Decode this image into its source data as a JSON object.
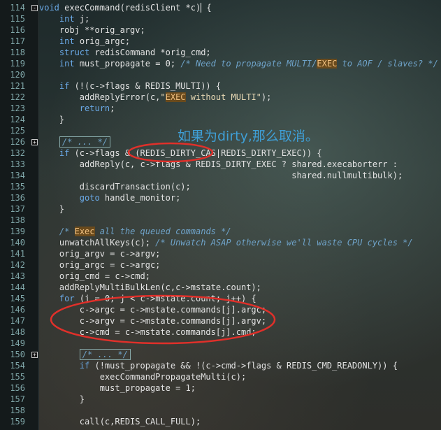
{
  "editor": {
    "lines": [
      {
        "num": "114",
        "fold": "-",
        "code": [
          [
            "void",
            "kw"
          ],
          [
            " execCommand(redisClient *c)",
            ""
          ],
          [
            "",
            "cursor"
          ],
          [
            " {",
            ""
          ]
        ]
      },
      {
        "num": "115",
        "code": [
          [
            "    ",
            ""
          ],
          [
            "int",
            "kw"
          ],
          [
            " j;",
            ""
          ]
        ]
      },
      {
        "num": "116",
        "code": [
          [
            "    robj **orig_argv;",
            ""
          ]
        ]
      },
      {
        "num": "117",
        "code": [
          [
            "    ",
            ""
          ],
          [
            "int",
            "kw"
          ],
          [
            " orig_argc;",
            ""
          ]
        ]
      },
      {
        "num": "118",
        "code": [
          [
            "    ",
            ""
          ],
          [
            "struct",
            "kw"
          ],
          [
            " redisCommand *orig_cmd;",
            ""
          ]
        ]
      },
      {
        "num": "119",
        "code": [
          [
            "    ",
            ""
          ],
          [
            "int",
            "kw"
          ],
          [
            " must_propagate = 0; ",
            ""
          ],
          [
            "/* Need to propagate MULTI/",
            "cm"
          ],
          [
            "EXEC",
            "hl"
          ],
          [
            " to AOF / slaves? */",
            "cm"
          ]
        ]
      },
      {
        "num": "120",
        "code": []
      },
      {
        "num": "121",
        "code": [
          [
            "    ",
            ""
          ],
          [
            "if",
            "kw"
          ],
          [
            " (!(c->flags & REDIS_MULTI)) {",
            ""
          ]
        ]
      },
      {
        "num": "122",
        "code": [
          [
            "        addReplyError(c,",
            ""
          ],
          [
            "\"",
            "str"
          ],
          [
            "EXEC",
            "hl"
          ],
          [
            " without MULTI\"",
            "str"
          ],
          [
            ");",
            ""
          ]
        ]
      },
      {
        "num": "123",
        "code": [
          [
            "        ",
            ""
          ],
          [
            "return",
            "kw"
          ],
          [
            ";",
            ""
          ]
        ]
      },
      {
        "num": "124",
        "code": [
          [
            "    }",
            ""
          ]
        ]
      },
      {
        "num": "125",
        "code": []
      },
      {
        "num": "126",
        "fold": "+",
        "code": [
          [
            "    ",
            ""
          ],
          [
            "/* ... */",
            "fold-box"
          ]
        ]
      },
      {
        "num": "132",
        "code": [
          [
            "    ",
            ""
          ],
          [
            "if",
            "kw"
          ],
          [
            " (c->flags & (REDIS_DIRTY_CAS|REDIS_DIRTY_EXEC)) {",
            ""
          ]
        ]
      },
      {
        "num": "133",
        "code": [
          [
            "        addReply(c, c->flags & REDIS_DIRTY_EXEC ? shared.execaborterr :",
            ""
          ]
        ]
      },
      {
        "num": "134",
        "code": [
          [
            "                                                  shared.nullmultibulk);",
            ""
          ]
        ]
      },
      {
        "num": "135",
        "code": [
          [
            "        discardTransaction(c);",
            ""
          ]
        ]
      },
      {
        "num": "136",
        "code": [
          [
            "        ",
            ""
          ],
          [
            "goto",
            "kw"
          ],
          [
            " handle_monitor;",
            ""
          ]
        ]
      },
      {
        "num": "137",
        "code": [
          [
            "    }",
            ""
          ]
        ]
      },
      {
        "num": "138",
        "code": []
      },
      {
        "num": "139",
        "code": [
          [
            "    ",
            ""
          ],
          [
            "/* ",
            "cm"
          ],
          [
            "Exec",
            "hl"
          ],
          [
            " all the queued commands */",
            "cm"
          ]
        ]
      },
      {
        "num": "140",
        "code": [
          [
            "    unwatchAllKeys(c); ",
            ""
          ],
          [
            "/* Unwatch ASAP otherwise we'll waste CPU cycles */",
            "cm"
          ]
        ]
      },
      {
        "num": "141",
        "code": [
          [
            "    orig_argv = c->argv;",
            ""
          ]
        ]
      },
      {
        "num": "142",
        "code": [
          [
            "    orig_argc = c->argc;",
            ""
          ]
        ]
      },
      {
        "num": "143",
        "code": [
          [
            "    orig_cmd = c->cmd;",
            ""
          ]
        ]
      },
      {
        "num": "144",
        "code": [
          [
            "    addReplyMultiBulkLen(c,c->mstate.count);",
            ""
          ]
        ]
      },
      {
        "num": "145",
        "code": [
          [
            "    ",
            ""
          ],
          [
            "for",
            "kw"
          ],
          [
            " (j = 0; j < c->mstate.count; j++) {",
            ""
          ]
        ]
      },
      {
        "num": "146",
        "code": [
          [
            "        c->argc = c->mstate.commands[j].argc;",
            ""
          ]
        ]
      },
      {
        "num": "147",
        "code": [
          [
            "        c->argv = c->mstate.commands[j].argv;",
            ""
          ]
        ]
      },
      {
        "num": "148",
        "code": [
          [
            "        c->cmd = c->mstate.commands[j].cmd;",
            ""
          ]
        ]
      },
      {
        "num": "149",
        "code": []
      },
      {
        "num": "150",
        "fold": "+",
        "code": [
          [
            "        ",
            ""
          ],
          [
            "/* ... */",
            "fold-box"
          ]
        ]
      },
      {
        "num": "154",
        "code": [
          [
            "        ",
            ""
          ],
          [
            "if",
            "kw"
          ],
          [
            " (!must_propagate && !(c->cmd->flags & REDIS_CMD_READONLY)) {",
            ""
          ]
        ]
      },
      {
        "num": "155",
        "code": [
          [
            "            execCommandPropagateMulti(c);",
            ""
          ]
        ]
      },
      {
        "num": "156",
        "code": [
          [
            "            must_propagate = 1;",
            ""
          ]
        ]
      },
      {
        "num": "157",
        "code": [
          [
            "        }",
            ""
          ]
        ]
      },
      {
        "num": "158",
        "code": []
      },
      {
        "num": "159",
        "code": [
          [
            "        call(c,REDIS_CALL_FULL);",
            ""
          ]
        ]
      }
    ],
    "annotation_text": "如果为dirty,那么取消。",
    "annotation_color": "#3f9fd6",
    "ellipse_color": "#e0302a"
  }
}
